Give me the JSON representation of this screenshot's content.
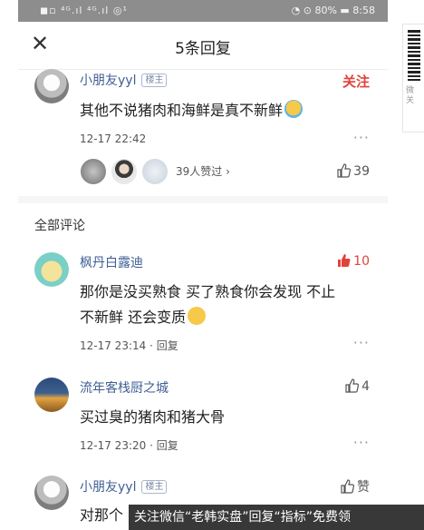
{
  "status_bar": {
    "left": "◼▫ ⁴ᴳ.ıl ⁴ᴳ.ıl ◎¹",
    "right": "◔ ⊙ 80% ▬ 8:58"
  },
  "nav": {
    "close": "✕",
    "title": "5条回复"
  },
  "main_comment": {
    "username": "小朋友yyl",
    "badge": "楼主",
    "follow": "关注",
    "text": "其他不说猪肉和海鲜是真不新鲜",
    "time": "12-17 22:42",
    "more": "···",
    "likers_text": "39人赞过 ›",
    "like_count": "39"
  },
  "section_label": "全部评论",
  "replies": [
    {
      "username": "枫丹白露迪",
      "like_count": "10",
      "text_line1": "那你是没买熟食 买了熟食你会发现 不止",
      "text_line2": "不新鲜 还会变质",
      "time": "12-17 23:14 · 回复",
      "more": "···"
    },
    {
      "username": "流年客栈厨之城",
      "like_count": "4",
      "text_line1": "买过臭的猪肉和猪大骨",
      "time": "12-17 23:20 · 回复",
      "more": "···"
    },
    {
      "username": "小朋友yyl",
      "badge": "楼主",
      "like_label": "赞",
      "text_line1": "对那个"
    }
  ],
  "side_card": {
    "text": "微关"
  },
  "watermark": "关注微信“老韩实盘”回复“指标”免费领",
  "colors": {
    "username": "#3f5f94",
    "accent_red": "#e0433a",
    "status_bar": "#8d8d8d"
  }
}
